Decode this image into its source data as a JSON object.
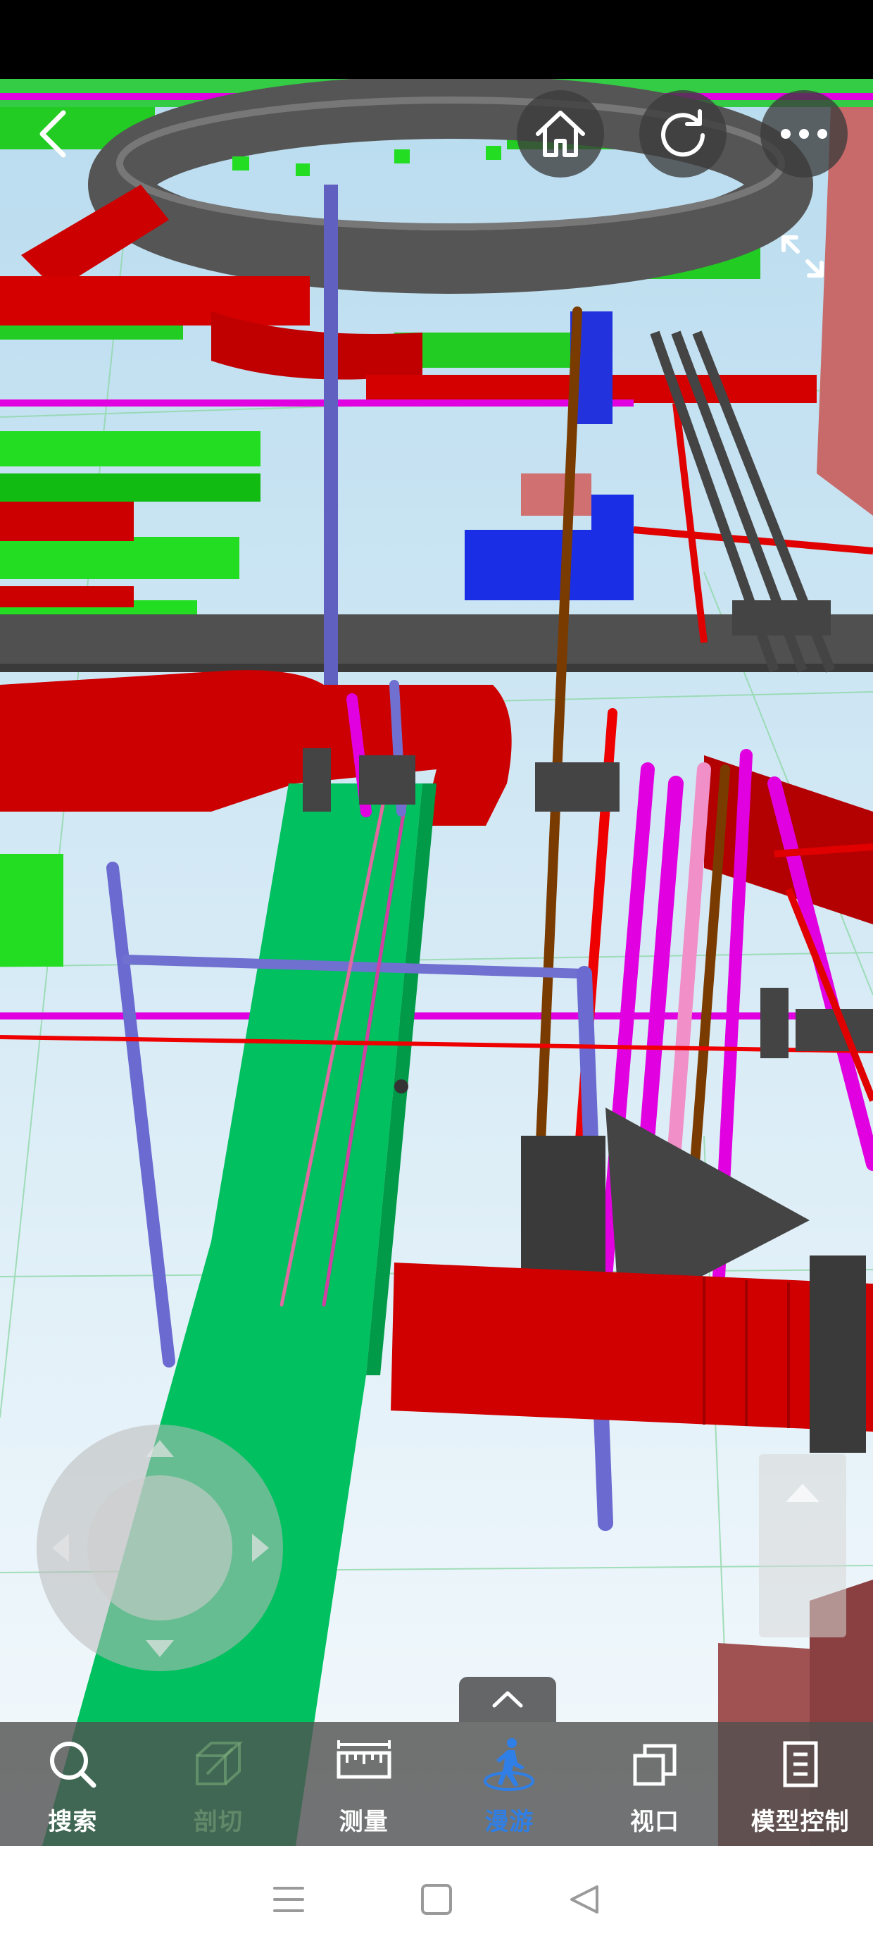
{
  "toolbar": {
    "items": [
      {
        "label": "搜索",
        "icon": "search-icon",
        "state": "normal"
      },
      {
        "label": "剖切",
        "icon": "section-box-icon",
        "state": "disabled"
      },
      {
        "label": "测量",
        "icon": "ruler-icon",
        "state": "normal"
      },
      {
        "label": "漫游",
        "icon": "walk-icon",
        "state": "active"
      },
      {
        "label": "视口",
        "icon": "viewport-icon",
        "state": "normal"
      },
      {
        "label": "模型控制",
        "icon": "model-control-icon",
        "state": "normal"
      }
    ]
  },
  "top_controls": {
    "icons": [
      "back-icon",
      "home-icon",
      "refresh-icon",
      "more-icon",
      "expand-icon"
    ]
  },
  "nav_bar": {
    "icons": [
      "menu-icon",
      "home-square-icon",
      "back-triangle-icon"
    ]
  },
  "colors": {
    "active": "#2f7fe6",
    "toolbar_bg": "#505050",
    "duct_red": "#d40000",
    "duct_green": "#00c060",
    "pipe_magenta": "#e000e0",
    "pipe_blue": "#7070d0",
    "duct_gray": "#505050"
  }
}
